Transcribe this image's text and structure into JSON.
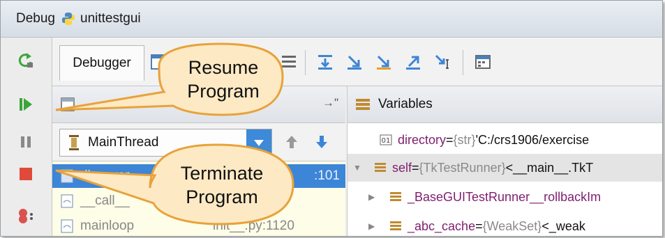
{
  "window": {
    "title_label": "Debug",
    "app_name": "unittestgui"
  },
  "toolbar": {
    "tab_label": "Debugger"
  },
  "frames_pane": {
    "thread": "MainThread",
    "items": [
      {
        "name": "discover",
        "line": ":101",
        "selected": true
      },
      {
        "name": "__call__",
        "line": "",
        "selected": false
      },
      {
        "name": "mainloop",
        "line": "init__.py:1120",
        "selected": false
      }
    ]
  },
  "variables_pane": {
    "title": "Variables",
    "rows": [
      {
        "name": "directory",
        "eq": " = ",
        "type": "{str}",
        "value": " 'C:/crs1906/exercise"
      },
      {
        "name": "self",
        "eq": " = ",
        "type": "{TkTestRunner}",
        "value": " <__main__.TkT"
      },
      {
        "name": "_BaseGUITestRunner__rollbackIm",
        "eq": "",
        "type": "",
        "value": ""
      },
      {
        "name": "_abc_cache",
        "eq": " = ",
        "type": "{WeakSet}",
        "value": " <_weak"
      }
    ]
  },
  "callouts": {
    "resume": "Resume\nProgram",
    "terminate": "Terminate\nProgram"
  },
  "colors": {
    "selection": "#3d85d6",
    "resume_green": "#3aa63a",
    "terminate_red": "#e04a3a",
    "callout_fill": "#fde9c4",
    "callout_stroke": "#e8a23a"
  }
}
